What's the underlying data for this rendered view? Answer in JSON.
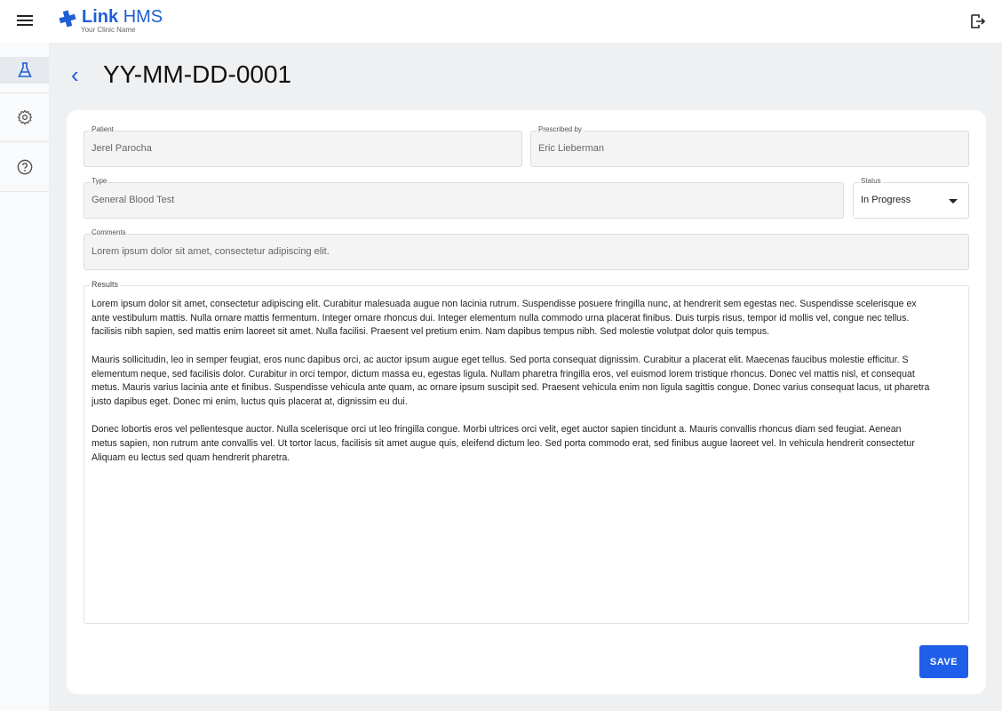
{
  "app": {
    "name_bold": "Link",
    "name_rest": "HMS",
    "subtitle": "Your Clinic Name"
  },
  "page": {
    "title": "YY-MM-DD-0001"
  },
  "form": {
    "patient": {
      "label": "Patient",
      "value": "Jerel Parocha"
    },
    "prescribed_by": {
      "label": "Prescribed by",
      "value": "Eric Lieberman"
    },
    "type": {
      "label": "Type",
      "value": "General Blood Test"
    },
    "status": {
      "label": "Status",
      "value": "In Progress"
    },
    "comments": {
      "label": "Comments",
      "value": "Lorem ipsum dolor sit amet, consectetur adipiscing elit."
    },
    "results": {
      "label": "Results",
      "paragraphs": [
        [
          "Lorem ipsum dolor sit amet, consectetur adipiscing elit. Curabitur malesuada augue non lacinia rutrum. Suspendisse posuere fringilla nunc, at hendrerit sem egestas nec. Suspendisse scelerisque ex",
          "ante vestibulum mattis. Nulla ornare mattis fermentum. Integer ornare rhoncus dui. Integer elementum nulla commodo urna placerat finibus. Duis turpis risus, tempor id mollis vel, congue nec tellus.",
          "facilisis nibh sapien, sed mattis enim laoreet sit amet. Nulla facilisi. Praesent vel pretium enim. Nam dapibus tempus nibh. Sed molestie volutpat dolor quis tempus."
        ],
        [
          "Mauris sollicitudin, leo in semper feugiat, eros nunc dapibus orci, ac auctor ipsum augue eget tellus. Sed porta consequat dignissim. Curabitur a placerat elit. Maecenas faucibus molestie efficitur. S",
          "elementum neque, sed facilisis dolor. Curabitur in orci tempor, dictum massa eu, egestas ligula. Nullam pharetra fringilla eros, vel euismod lorem tristique rhoncus. Donec vel mattis nisl, et consequat",
          "metus. Mauris varius lacinia ante et finibus. Suspendisse vehicula ante quam, ac ornare ipsum suscipit sed. Praesent vehicula enim non ligula sagittis congue. Donec varius consequat lacus, ut pharetra",
          "justo dapibus eget. Donec mi enim, luctus quis placerat at, dignissim eu dui."
        ],
        [
          "Donec lobortis eros vel pellentesque auctor. Nulla scelerisque orci ut leo fringilla congue. Morbi ultrices orci velit, eget auctor sapien tincidunt a. Mauris convallis rhoncus diam sed feugiat. Aenean",
          "metus sapien, non rutrum ante convallis vel. Ut tortor lacus, facilisis sit amet augue quis, eleifend dictum leo. Sed porta commodo erat, sed finibus augue laoreet vel. In vehicula hendrerit consectetur",
          "Aliquam eu lectus sed quam hendrerit pharetra."
        ]
      ]
    },
    "save_label": "SAVE"
  },
  "sidebar": {
    "items": [
      {
        "icon": "flask-icon",
        "active": true
      },
      {
        "icon": "gear-icon"
      },
      {
        "icon": "help-icon"
      }
    ]
  },
  "colors": {
    "accent": "#1f5ed6",
    "button": "#1f5ee8"
  }
}
